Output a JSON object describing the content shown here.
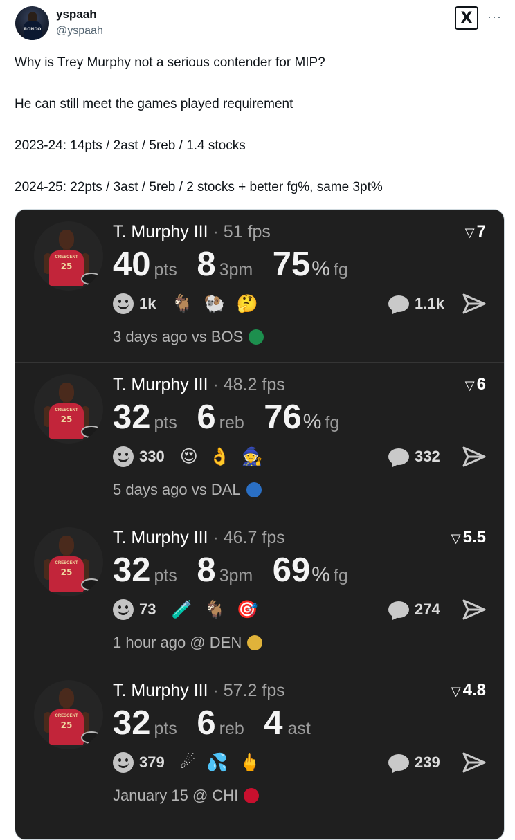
{
  "tweet": {
    "display_name": "yspaah",
    "handle": "@yspaah",
    "avatar_jersey_text": "RONDO",
    "more_label": "···",
    "logo_label": "X",
    "lines": [
      "Why is Trey Murphy not a serious contender for MIP?",
      "He can still meet the games played requirement",
      "2023-24: 14pts / 2ast / 5reb / 1.4 stocks",
      "2024-25: 22pts / 3ast / 5reb / 2 stocks + better fg%, same 3pt%"
    ]
  },
  "colors": {
    "card_bg": "#1f1f1f",
    "jersey_red": "#c2253a",
    "text_light": "#f4f4f4"
  },
  "entries": [
    {
      "player": "T. Murphy III",
      "separator": "·",
      "fps": "51 fps",
      "rank": "7",
      "stats": [
        {
          "value": "40",
          "label": "pts"
        },
        {
          "value": "8",
          "label": "3pm"
        },
        {
          "value": "75",
          "pct": "%",
          "label": "fg"
        }
      ],
      "reaction_count": "1k",
      "reactions": [
        "goat-emoji",
        "ram-emoji",
        "thinking-face-emoji"
      ],
      "reaction_glyphs": [
        "🐐",
        "🐏",
        "🤔"
      ],
      "comment_count": "1.1k",
      "time_text": "3 days ago vs BOS",
      "team_logo": "celtics-logo",
      "team_color": "#1d8f4e",
      "jersey_number": "25",
      "jersey_word": "CRESCENT"
    },
    {
      "player": "T. Murphy III",
      "separator": "·",
      "fps": "48.2 fps",
      "rank": "6",
      "stats": [
        {
          "value": "32",
          "label": "pts"
        },
        {
          "value": "6",
          "label": "reb"
        },
        {
          "value": "76",
          "pct": "%",
          "label": "fg"
        }
      ],
      "reaction_count": "330",
      "reactions": [
        "heart-eyes-emoji",
        "ok-hand-emoji",
        "character-emoji"
      ],
      "reaction_glyphs": [
        "😍",
        "👌",
        "🧙"
      ],
      "comment_count": "332",
      "time_text": "5 days ago vs DAL",
      "team_logo": "mavericks-logo",
      "team_color": "#2a6fc4",
      "jersey_number": "25",
      "jersey_word": "CRESCENT"
    },
    {
      "player": "T. Murphy III",
      "separator": "·",
      "fps": "46.7 fps",
      "rank": "5.5",
      "stats": [
        {
          "value": "32",
          "label": "pts"
        },
        {
          "value": "8",
          "label": "3pm"
        },
        {
          "value": "69",
          "pct": "%",
          "label": "fg"
        }
      ],
      "reaction_count": "73",
      "reactions": [
        "test-tube-emoji",
        "goat-emoji",
        "bullseye-emoji"
      ],
      "reaction_glyphs": [
        "🧪",
        "🐐",
        "🎯"
      ],
      "comment_count": "274",
      "time_text": "1 hour ago @ DEN",
      "team_logo": "nuggets-logo",
      "team_color": "#e0b33a",
      "jersey_number": "25",
      "jersey_word": "CRESCENT"
    },
    {
      "player": "T. Murphy III",
      "separator": "·",
      "fps": "57.2 fps",
      "rank": "4.8",
      "stats": [
        {
          "value": "32",
          "label": "pts"
        },
        {
          "value": "6",
          "label": "reb"
        },
        {
          "value": "4",
          "label": "ast"
        }
      ],
      "reaction_count": "379",
      "reactions": [
        "comet-emoji",
        "sweat-droplets-emoji",
        "middle-finger-emoji"
      ],
      "reaction_glyphs": [
        "☄",
        "💦",
        "🖕"
      ],
      "comment_count": "239",
      "time_text": "January 15 @ CHI",
      "team_logo": "bulls-logo",
      "team_color": "#c8102e",
      "jersey_number": "25",
      "jersey_word": "CRESCENT"
    }
  ]
}
